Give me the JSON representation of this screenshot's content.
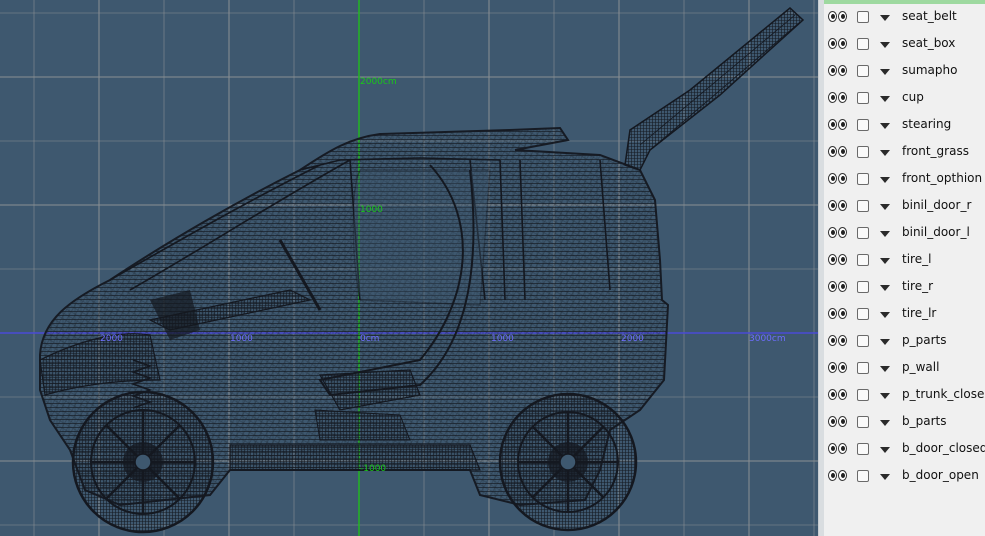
{
  "viewport": {
    "x_axis_labels": [
      "2000",
      "1000",
      "0cm",
      "1000",
      "2000",
      "3000cm"
    ],
    "y_axis_labels": [
      "2000cm",
      "1000",
      "-1000"
    ],
    "colors": {
      "background": "#3e586f",
      "grid": "#8a8f93",
      "x_axis": "#4a4ad6",
      "y_axis": "#22b522",
      "wire": "#141820"
    }
  },
  "layers_panel": {
    "items": [
      {
        "name": "seat_belt"
      },
      {
        "name": "seat_box"
      },
      {
        "name": "sumapho"
      },
      {
        "name": "cup"
      },
      {
        "name": "stearing"
      },
      {
        "name": "front_grass"
      },
      {
        "name": "front_opthion"
      },
      {
        "name": "binil_door_r"
      },
      {
        "name": "binil_door_l"
      },
      {
        "name": "tire_l"
      },
      {
        "name": "tire_r"
      },
      {
        "name": "tire_lr"
      },
      {
        "name": "p_parts"
      },
      {
        "name": "p_wall"
      },
      {
        "name": "p_trunk_closed"
      },
      {
        "name": "b_parts"
      },
      {
        "name": "b_door_closed"
      },
      {
        "name": "b_door_open"
      }
    ]
  }
}
